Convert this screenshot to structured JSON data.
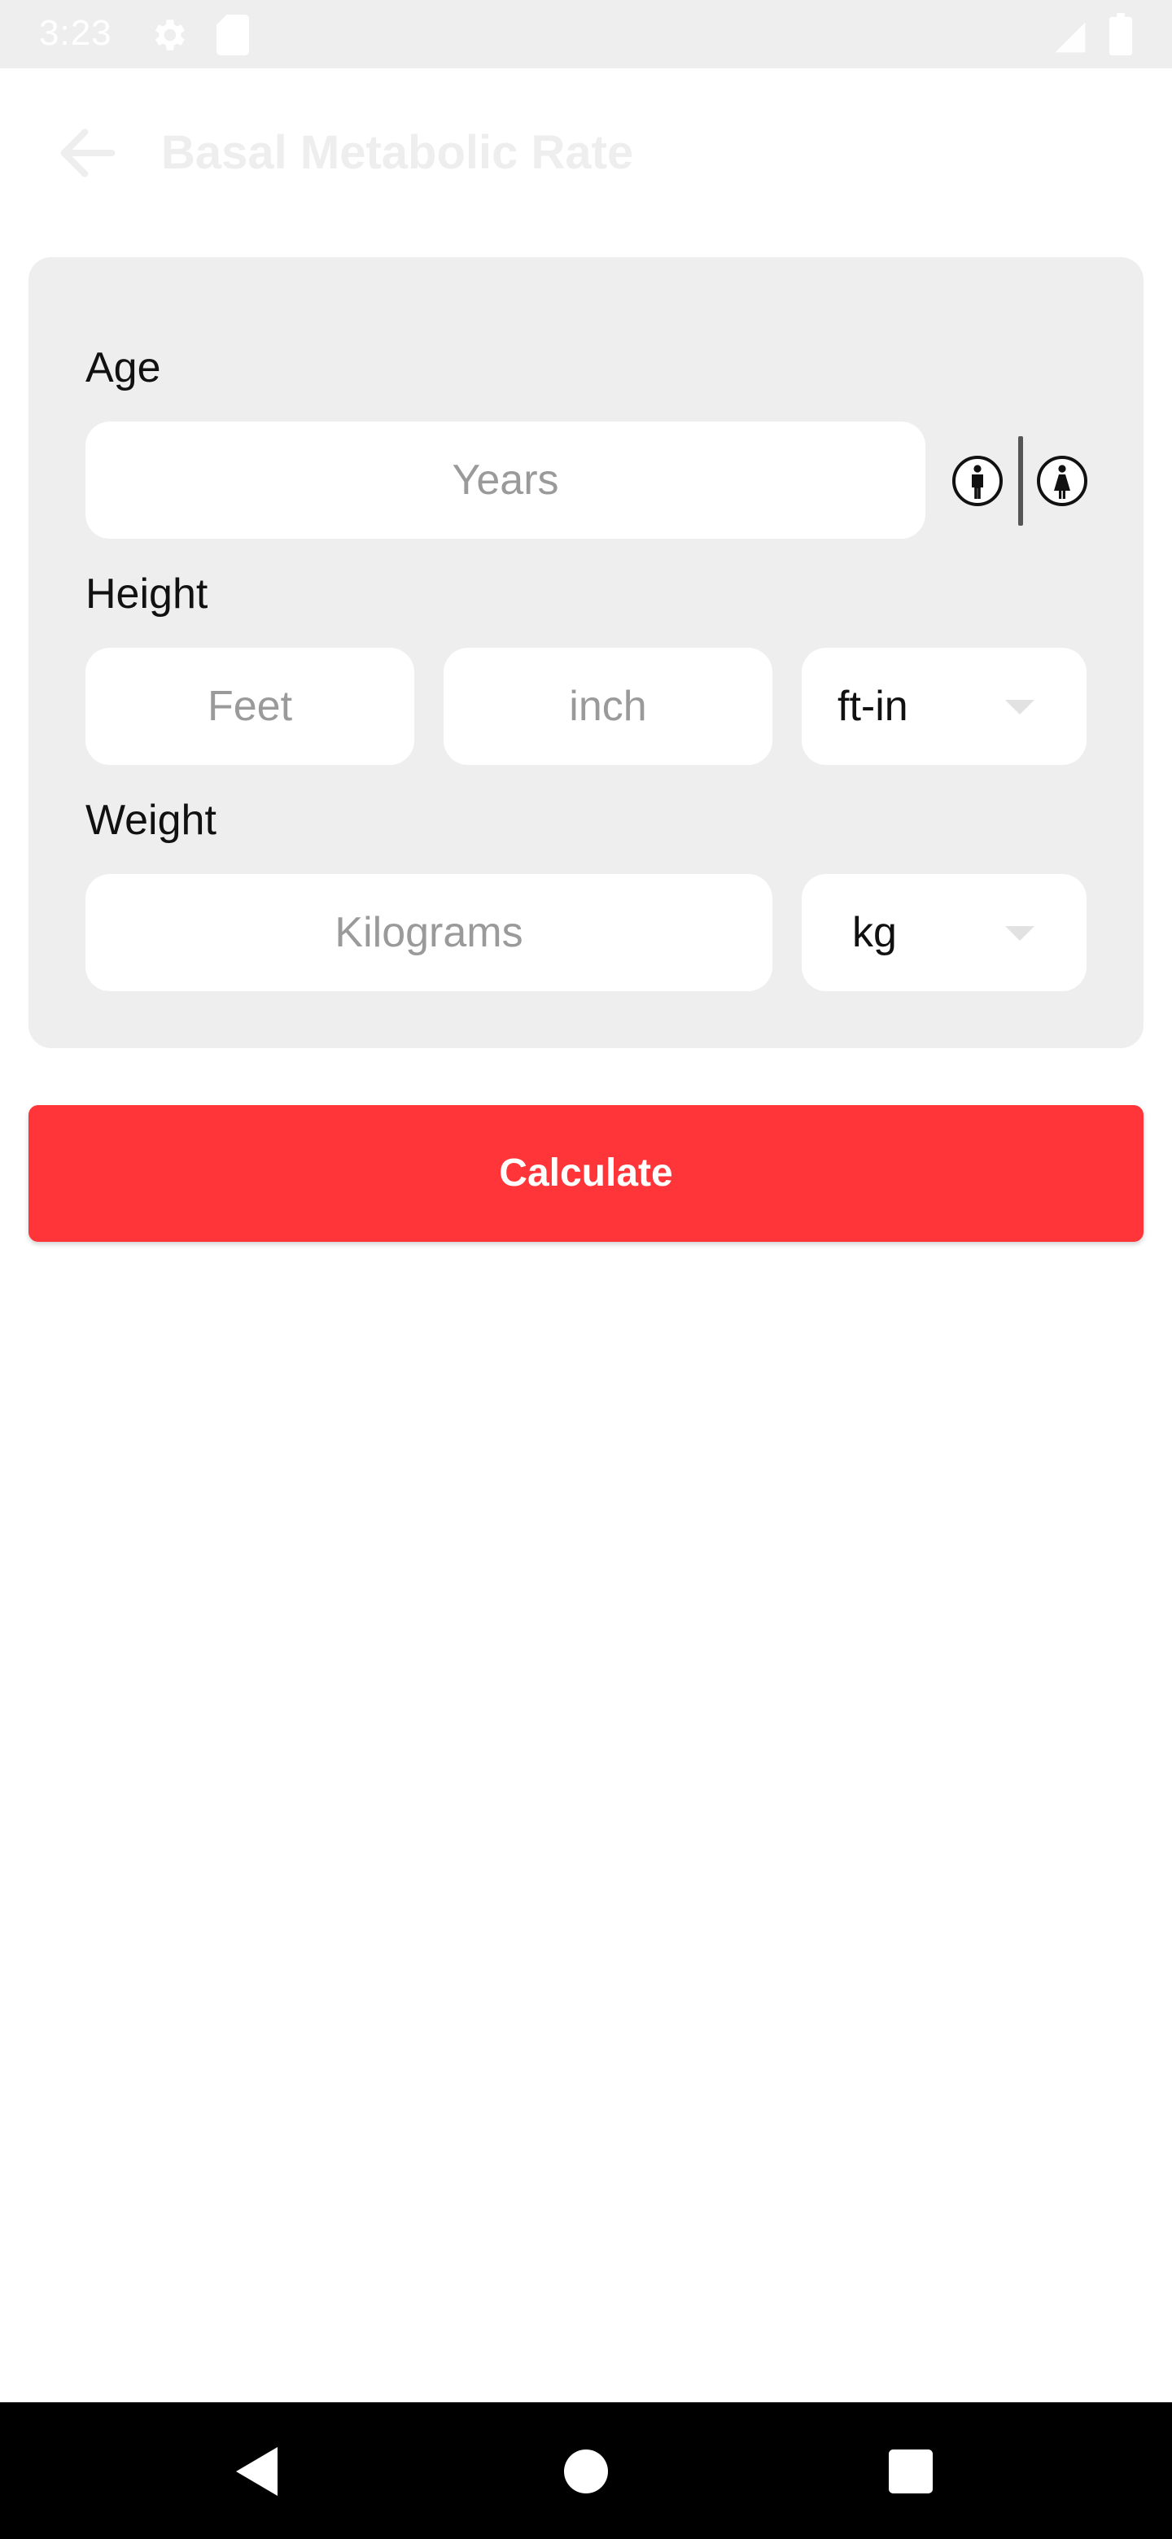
{
  "status_bar": {
    "time": "3:23",
    "icons": [
      "gear-icon",
      "sd-card-icon",
      "signal-icon",
      "battery-icon"
    ]
  },
  "app_bar": {
    "back_icon": "arrow-left-icon",
    "title": "Basal Metabolic Rate"
  },
  "form": {
    "age": {
      "label": "Age",
      "placeholder": "Years",
      "value": "",
      "gender_icons": [
        "male-icon",
        "female-icon"
      ]
    },
    "height": {
      "label": "Height",
      "feet_placeholder": "Feet",
      "inch_placeholder": "inch",
      "unit_selected": "ft-in"
    },
    "weight": {
      "label": "Weight",
      "placeholder": "Kilograms",
      "unit_selected": "kg"
    }
  },
  "actions": {
    "calculate_label": "Calculate"
  },
  "nav_bar": {
    "icons": [
      "back-triangle-icon",
      "home-circle-icon",
      "recents-square-icon"
    ]
  },
  "colors": {
    "accent": "#ff3539",
    "card_bg": "#eeeeee",
    "status_bar_bg": "#eeeeee",
    "nav_bar_bg": "#000000"
  }
}
